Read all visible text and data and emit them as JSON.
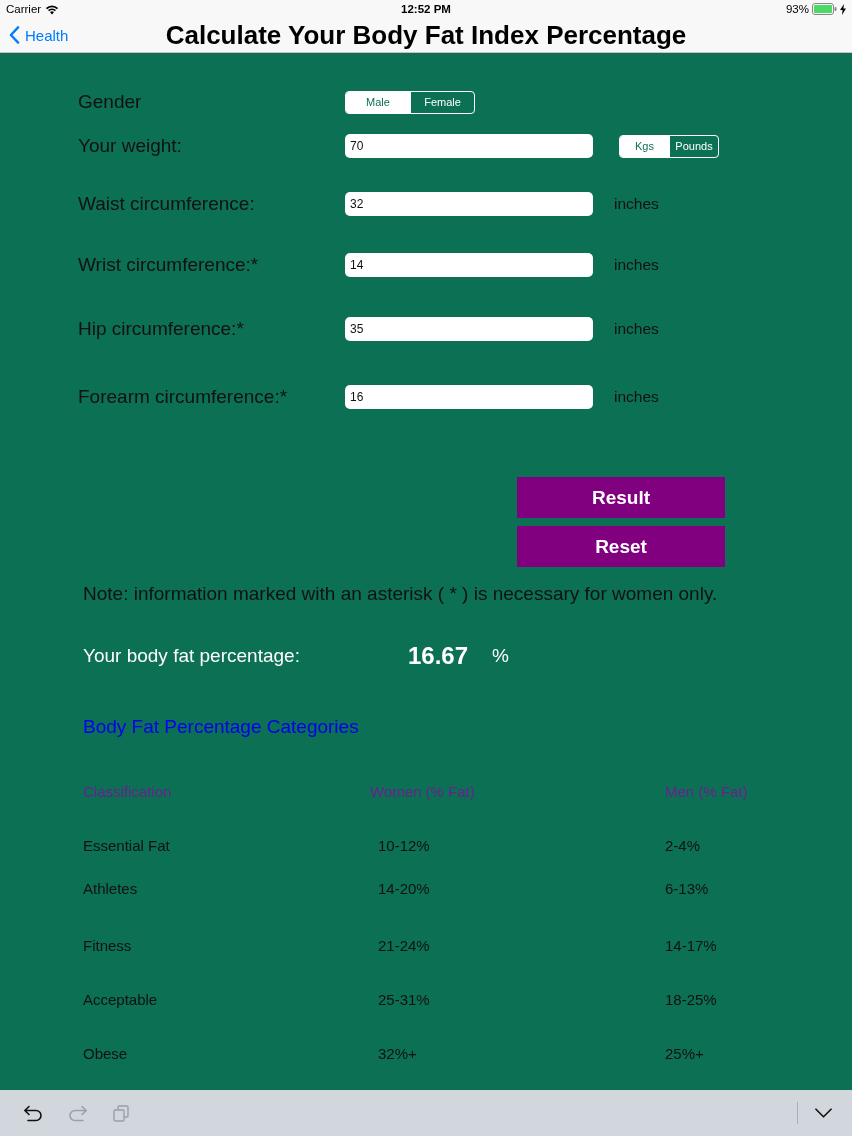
{
  "status_bar": {
    "carrier": "Carrier",
    "time": "12:52 PM",
    "battery": "93%"
  },
  "nav_bar": {
    "back": "Health",
    "title": "Calculate Your Body Fat Index Percentage"
  },
  "gender": {
    "label": "Gender",
    "options": [
      {
        "label": "Male",
        "selected": true
      },
      {
        "label": "Female",
        "selected": false
      }
    ]
  },
  "fields": [
    {
      "kind": "toggle",
      "label": "Your weight:",
      "value": "70",
      "units": [
        {
          "label": "Kgs",
          "selected": true
        },
        {
          "label": "Pounds",
          "selected": false
        }
      ]
    },
    {
      "kind": "text",
      "label": "Waist circumference:",
      "value": "32",
      "unit": "inches"
    },
    {
      "kind": "text",
      "label": "Wrist circumference:*",
      "value": "14",
      "unit": "inches"
    },
    {
      "kind": "text",
      "label": "Hip circumference:*",
      "value": "35",
      "unit": "inches"
    },
    {
      "kind": "text",
      "label": "Forearm circumference:*",
      "value": "16",
      "unit": "inches"
    }
  ],
  "buttons": [
    "Result",
    "Reset"
  ],
  "note": "Note: information marked with an asterisk ( * ) is necessary for women only.",
  "result": {
    "label": "Your body fat percentage:",
    "value": "16.67",
    "unit": "%"
  },
  "categories": {
    "link": "Body Fat Percentage Categories",
    "columns": [
      "Classification",
      "Women (% Fat)",
      "Men (% Fat)"
    ],
    "rows": [
      [
        "Essential Fat",
        "10-12%",
        "2-4%"
      ],
      [
        "Athletes",
        "14-20%",
        "6-13%"
      ],
      [
        "Fitness",
        "21-24%",
        "14-17%"
      ],
      [
        "Acceptable",
        "25-31%",
        "18-25%"
      ],
      [
        "Obese",
        "32%+",
        "25%+"
      ]
    ]
  },
  "toolbar": {
    "items": [
      {
        "kind": "undo",
        "disabled": false
      },
      {
        "kind": "redo",
        "disabled": true
      },
      {
        "kind": "copy",
        "disabled": true
      }
    ]
  }
}
